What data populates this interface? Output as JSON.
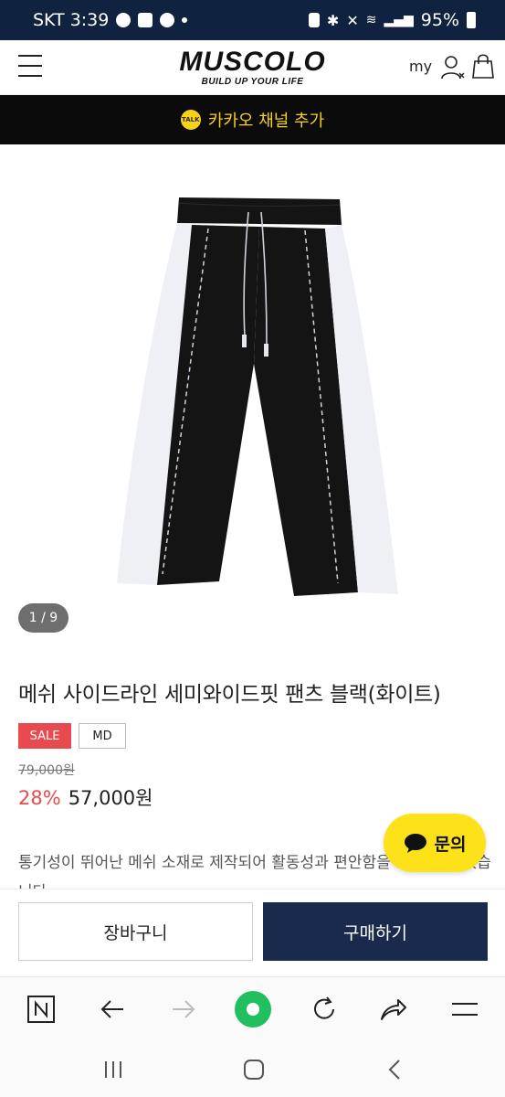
{
  "status_bar": {
    "carrier_time": "SKT 3:39",
    "talk_icon": "TALK",
    "battery": "95%"
  },
  "header": {
    "brand": "MUSCOLO",
    "tagline": "BUILD UP YOUR LIFE",
    "my_label": "my"
  },
  "kakao": {
    "label": "카카오 채널 추가",
    "icon_text": "TALK"
  },
  "gallery": {
    "counter": "1 / 9"
  },
  "product": {
    "title": "메쉬 사이드라인 세미와이드핏 팬츠 블랙(화이트)",
    "badges": {
      "sale": "SALE",
      "md": "MD"
    },
    "original_price": "79,000원",
    "discount": "28%",
    "price": "57,000원",
    "description": "통기성이 뛰어난 메쉬 소재로 제작되어 활동성과 편안함을 느끼실 수 있습니다."
  },
  "inquiry_label": "문의",
  "actions": {
    "cart": "장바구니",
    "buy": "구매하기"
  },
  "colors": {
    "header_navy": "#0f2340",
    "sale_red": "#e94a4f",
    "buy_navy": "#1a2a4c",
    "kakao_yellow": "#f7d21a",
    "green_home": "#20c060"
  },
  "icons": [
    "menu-icon",
    "user-icon",
    "shopping-bag-icon",
    "kakao-talk-icon",
    "chat-bubble-icon",
    "naver-n-icon",
    "back-arrow-icon",
    "forward-arrow-icon",
    "home-dot-icon",
    "refresh-icon",
    "share-icon",
    "more-menu-icon",
    "recents-icon",
    "home-icon",
    "back-icon"
  ]
}
